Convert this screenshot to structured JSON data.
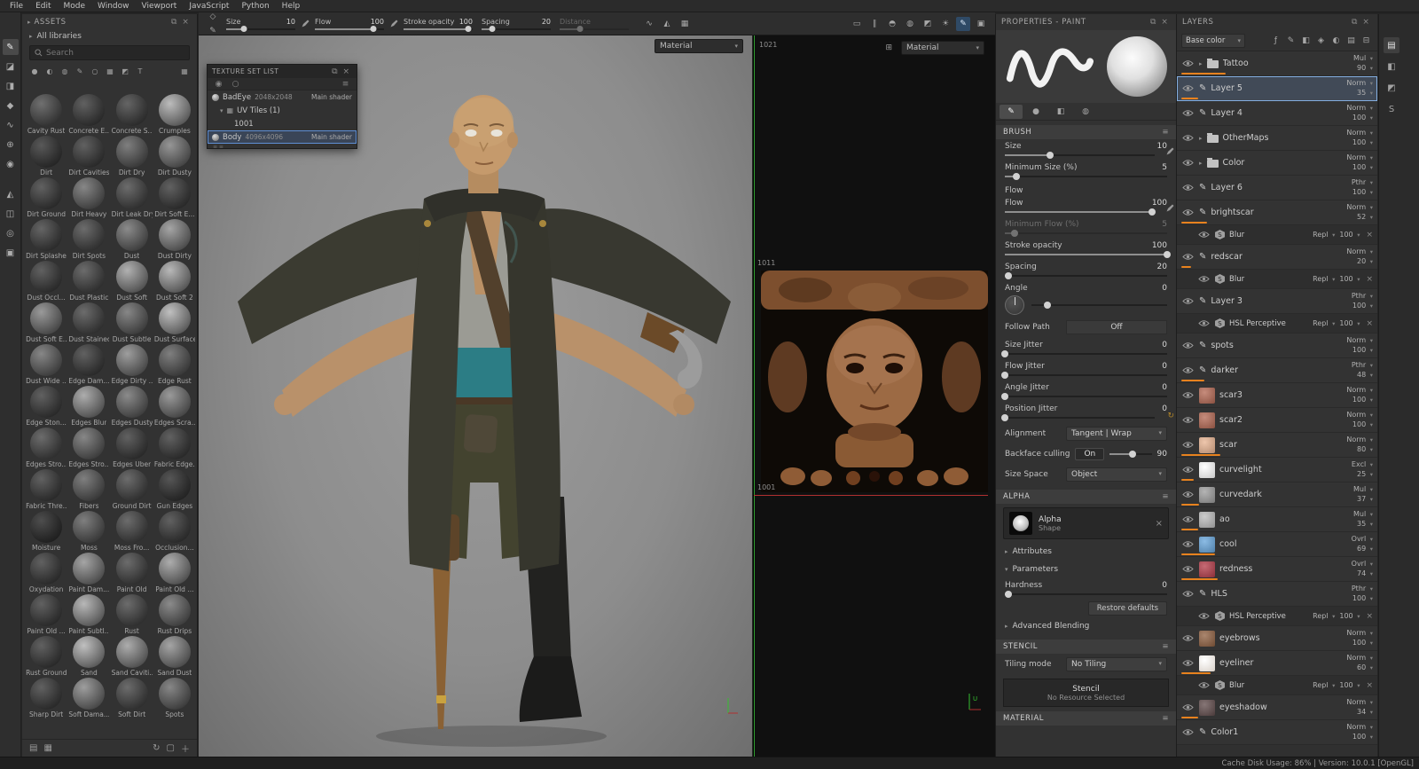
{
  "menu": {
    "items": [
      "File",
      "Edit",
      "Mode",
      "Window",
      "Viewport",
      "JavaScript",
      "Python",
      "Help"
    ]
  },
  "toolbar": {
    "left_icons": [
      {
        "name": "stroke-options-icon",
        "glyph": "◇"
      },
      {
        "name": "pen-pressure-icon",
        "glyph": "✎"
      }
    ],
    "groups": [
      {
        "label": "Size",
        "value": "10",
        "frac": 0.25,
        "pen": true
      },
      {
        "label": "Flow",
        "value": "100",
        "frac": 0.85,
        "pen": true
      },
      {
        "label": "Stroke opacity",
        "value": "100",
        "frac": 0.94
      },
      {
        "label": "Spacing",
        "value": "20",
        "frac": 0.15
      },
      {
        "label": "Distance",
        "value": "",
        "frac": 0.3,
        "disabled": true
      }
    ],
    "mid_icons": [
      {
        "name": "lazy-mouse-icon",
        "glyph": "∿"
      },
      {
        "name": "symmetry-icon",
        "glyph": "◭"
      },
      {
        "name": "tiling-icon",
        "glyph": "▦"
      }
    ],
    "viewport_icons": [
      {
        "name": "display-mode-icon",
        "glyph": "▭"
      },
      {
        "name": "pause-physics-icon",
        "glyph": "∥"
      },
      {
        "name": "simulation-icon",
        "glyph": "◓"
      },
      {
        "name": "environment-icon",
        "glyph": "◍"
      },
      {
        "name": "shader-settings-icon",
        "glyph": "◩"
      },
      {
        "name": "post-effects-icon",
        "glyph": "☀"
      },
      {
        "name": "paint-mode-icon",
        "glyph": "✎",
        "active": true
      },
      {
        "name": "camera-icon",
        "glyph": "▣"
      }
    ]
  },
  "tools": [
    {
      "name": "paint-tool",
      "glyph": "✎",
      "active": true
    },
    {
      "name": "eraser-tool",
      "glyph": "◪"
    },
    {
      "name": "projection-tool",
      "glyph": "◨"
    },
    {
      "name": "polygon-fill-tool",
      "glyph": "◆"
    },
    {
      "name": "smudge-tool",
      "glyph": "∿"
    },
    {
      "name": "clone-tool",
      "glyph": "⊕"
    },
    {
      "name": "material-picker-tool",
      "glyph": "◉"
    },
    {
      "name": "quick-mask-tool",
      "glyph": "◭",
      "gap": true
    },
    {
      "name": "symmetry-panel-tool",
      "glyph": "◫"
    },
    {
      "name": "viewer-settings-tool",
      "glyph": "◎"
    },
    {
      "name": "render-mode-tool",
      "glyph": "▣"
    }
  ],
  "assets": {
    "title": "ASSETS",
    "library_label": "All libraries",
    "search_placeholder": "Search",
    "filters": [
      {
        "name": "filter-materials-icon",
        "glyph": "●"
      },
      {
        "name": "filter-smart-materials-icon",
        "glyph": "◐"
      },
      {
        "name": "filter-smart-masks-icon",
        "glyph": "◍"
      },
      {
        "name": "filter-brushes-icon",
        "glyph": "✎"
      },
      {
        "name": "filter-alphas-icon",
        "glyph": "○"
      },
      {
        "name": "filter-textures-icon",
        "glyph": "▦"
      },
      {
        "name": "filter-environments-icon",
        "glyph": "◩"
      },
      {
        "name": "filter-fonts-icon",
        "glyph": "T"
      }
    ],
    "grid_view_icon": "▦",
    "items": [
      {
        "label": "Cavity Rust",
        "shade": 0.38
      },
      {
        "label": "Concrete E...",
        "shade": 0.3
      },
      {
        "label": "Concrete S...",
        "shade": 0.32
      },
      {
        "label": "Crumples",
        "shade": 0.78
      },
      {
        "label": "Dirt",
        "shade": 0.26
      },
      {
        "label": "Dirt Cavities",
        "shade": 0.3
      },
      {
        "label": "Dirt Dry",
        "shade": 0.46
      },
      {
        "label": "Dirt Dusty",
        "shade": 0.58
      },
      {
        "label": "Dirt Ground",
        "shade": 0.3
      },
      {
        "label": "Dirt Heavy",
        "shade": 0.5
      },
      {
        "label": "Dirt Leak Dry",
        "shade": 0.36
      },
      {
        "label": "Dirt Soft E...",
        "shade": 0.3
      },
      {
        "label": "Dirt Splashes",
        "shade": 0.32
      },
      {
        "label": "Dirt Spots",
        "shade": 0.36
      },
      {
        "label": "Dust",
        "shade": 0.52
      },
      {
        "label": "Dust Dirty",
        "shade": 0.66
      },
      {
        "label": "Dust Occl...",
        "shade": 0.3
      },
      {
        "label": "Dust Plastic",
        "shade": 0.36
      },
      {
        "label": "Dust Soft",
        "shade": 0.72
      },
      {
        "label": "Dust Soft 2",
        "shade": 0.76
      },
      {
        "label": "Dust Soft E...",
        "shade": 0.6
      },
      {
        "label": "Dust Stained",
        "shade": 0.36
      },
      {
        "label": "Dust Subtle",
        "shade": 0.5
      },
      {
        "label": "Dust Surface",
        "shade": 0.8
      },
      {
        "label": "Dust Wide ...",
        "shade": 0.5
      },
      {
        "label": "Edge Dam...",
        "shade": 0.3
      },
      {
        "label": "Edge Dirty ...",
        "shade": 0.62
      },
      {
        "label": "Edge Rust",
        "shade": 0.46
      },
      {
        "label": "Edge Ston...",
        "shade": 0.3
      },
      {
        "label": "Edges Blur",
        "shade": 0.7
      },
      {
        "label": "Edges Dusty",
        "shade": 0.52
      },
      {
        "label": "Edges Scra...",
        "shade": 0.6
      },
      {
        "label": "Edges Stro...",
        "shade": 0.36
      },
      {
        "label": "Edges Stro...",
        "shade": 0.5
      },
      {
        "label": "Edges Uber",
        "shade": 0.3
      },
      {
        "label": "Fabric Edge...",
        "shade": 0.3
      },
      {
        "label": "Fabric Thre...",
        "shade": 0.3
      },
      {
        "label": "Fibers",
        "shade": 0.46
      },
      {
        "label": "Ground Dirt",
        "shade": 0.36
      },
      {
        "label": "Gun Edges",
        "shade": 0.24
      },
      {
        "label": "Moisture",
        "shade": 0.2
      },
      {
        "label": "Moss",
        "shade": 0.46
      },
      {
        "label": "Moss Fro...",
        "shade": 0.36
      },
      {
        "label": "Occlusion...",
        "shade": 0.3
      },
      {
        "label": "Oxydation",
        "shade": 0.3
      },
      {
        "label": "Paint Dam...",
        "shade": 0.66
      },
      {
        "label": "Paint Old",
        "shade": 0.36
      },
      {
        "label": "Paint Old ...",
        "shade": 0.7
      },
      {
        "label": "Paint Old ...",
        "shade": 0.3
      },
      {
        "label": "Paint Subtl...",
        "shade": 0.76
      },
      {
        "label": "Rust",
        "shade": 0.36
      },
      {
        "label": "Rust Drips",
        "shade": 0.52
      },
      {
        "label": "Rust Ground",
        "shade": 0.3
      },
      {
        "label": "Sand",
        "shade": 0.8
      },
      {
        "label": "Sand Caviti...",
        "shade": 0.7
      },
      {
        "label": "Sand Dust",
        "shade": 0.66
      },
      {
        "label": "Sharp Dirt",
        "shade": 0.3
      },
      {
        "label": "Soft Dama...",
        "shade": 0.62
      },
      {
        "label": "Soft Dirt",
        "shade": 0.36
      },
      {
        "label": "Spots",
        "shade": 0.5
      }
    ]
  },
  "texture_set_list": {
    "title": "TEXTURE SET LIST",
    "rows": [
      {
        "name": "BadEye",
        "res": "2048x2048",
        "shader": "Main shader"
      },
      {
        "name": "UV Tiles (1)"
      },
      {
        "name": "1001"
      },
      {
        "name": "Body",
        "res": "4096x4096",
        "shader": "Main shader",
        "selected": true
      }
    ]
  },
  "viewport3d": {
    "material": "Material"
  },
  "viewport2d": {
    "material": "Material",
    "tile_top": "1021",
    "tile_mid": "1011",
    "tile_bottom": "1001",
    "axis_label": "U"
  },
  "properties": {
    "title": "PROPERTIES - PAINT",
    "tabs": [
      {
        "name": "tab-brush",
        "glyph": "✎",
        "active": true
      },
      {
        "name": "tab-alpha",
        "glyph": "●"
      },
      {
        "name": "tab-stencil",
        "glyph": "◧"
      },
      {
        "name": "tab-material",
        "glyph": "◍"
      }
    ],
    "brush_header": "BRUSH",
    "params": [
      {
        "type": "slider",
        "label": "Size",
        "value": "10",
        "frac": 0.3,
        "pen": true
      },
      {
        "type": "slider",
        "label": "Minimum Size (%)",
        "value": "5",
        "frac": 0.07
      },
      {
        "type": "subheader",
        "label": "Flow"
      },
      {
        "type": "slider",
        "label": "Flow",
        "value": "100",
        "frac": 0.98,
        "pen": true
      },
      {
        "type": "slider",
        "label": "Minimum Flow (%)",
        "value": "5",
        "frac": 0.06,
        "disabled": true
      },
      {
        "type": "slider",
        "label": "Stroke opacity",
        "value": "100",
        "frac": 1
      },
      {
        "type": "slider",
        "label": "Spacing",
        "value": "20",
        "frac": 0.02
      },
      {
        "type": "angle",
        "label": "Angle",
        "value": "0"
      },
      {
        "type": "dropdown",
        "label": "Follow Path",
        "value": "Off",
        "flat": true
      },
      {
        "type": "slider",
        "label": "Size Jitter",
        "value": "0",
        "frac": 0
      },
      {
        "type": "slider",
        "label": "Flow Jitter",
        "value": "0",
        "frac": 0
      },
      {
        "type": "slider",
        "label": "Angle Jitter",
        "value": "0",
        "frac": 0
      },
      {
        "type": "slider",
        "label": "Position Jitter",
        "value": "0",
        "frac": 0,
        "dice": true
      },
      {
        "type": "dropdown",
        "label": "Alignment",
        "value": "Tangent | Wrap"
      },
      {
        "type": "toggle",
        "label": "Backface culling",
        "value": "On",
        "extra": "90",
        "frac": 0.55
      },
      {
        "type": "dropdown",
        "label": "Size Space",
        "value": "Object"
      }
    ],
    "alpha_header": "ALPHA",
    "alpha": {
      "name": "Alpha",
      "sub": "Shape"
    },
    "attributes_label": "Attributes",
    "parameters_label": "Parameters",
    "hardness": {
      "label": "Hardness",
      "value": "0"
    },
    "restore_label": "Restore defaults",
    "advanced_label": "Advanced Blending",
    "stencil_header": "STENCIL",
    "tiling_label": "Tiling mode",
    "tiling_value": "No Tiling",
    "stencil_box": {
      "name": "Stencil",
      "sub": "No Resource Selected"
    },
    "material_header": "MATERIAL"
  },
  "layers": {
    "title": "LAYERS",
    "channel": "Base color",
    "header_icons": [
      {
        "name": "add-effect-icon",
        "glyph": "ƒ"
      },
      {
        "name": "add-paint-layer-icon",
        "glyph": "✎"
      },
      {
        "name": "add-fill-layer-icon",
        "glyph": "◧"
      },
      {
        "name": "add-smart-material-icon",
        "glyph": "◈"
      },
      {
        "name": "add-smart-mask-icon",
        "glyph": "◐"
      },
      {
        "name": "add-folder-icon",
        "glyph": "▤"
      },
      {
        "name": "delete-layer-icon",
        "glyph": "⊟"
      }
    ],
    "items": [
      {
        "kind": "folder",
        "name": "Tattoo",
        "blend": "Mul",
        "opacity": 90
      },
      {
        "kind": "paint",
        "name": "Layer 5",
        "blend": "Norm",
        "opacity": 35,
        "selected": true
      },
      {
        "kind": "paint",
        "name": "Layer 4",
        "blend": "Norm",
        "opacity": 100
      },
      {
        "kind": "folder",
        "name": "OtherMaps",
        "blend": "Norm",
        "opacity": 100
      },
      {
        "kind": "folder",
        "name": "Color",
        "blend": "Norm",
        "opacity": 100
      },
      {
        "kind": "paint",
        "name": "Layer 6",
        "blend": "Pthr",
        "opacity": 100
      },
      {
        "kind": "paint",
        "name": "brightscar",
        "blend": "Norm",
        "opacity": 52
      },
      {
        "kind": "effect",
        "name": "Blur",
        "blend": "Repl",
        "opacity": 100
      },
      {
        "kind": "paint",
        "name": "redscar",
        "blend": "Norm",
        "opacity": 20
      },
      {
        "kind": "effect",
        "name": "Blur",
        "blend": "Repl",
        "opacity": 100
      },
      {
        "kind": "paint",
        "name": "Layer 3",
        "blend": "Pthr",
        "opacity": 100
      },
      {
        "kind": "effect",
        "name": "HSL Perceptive",
        "blend": "Repl",
        "opacity": 100
      },
      {
        "kind": "paint",
        "name": "spots",
        "blend": "Norm",
        "opacity": 100
      },
      {
        "kind": "paint",
        "name": "darker",
        "blend": "Pthr",
        "opacity": 48
      },
      {
        "kind": "fill",
        "name": "scar3",
        "blend": "Norm",
        "opacity": 100,
        "thumb": "#8a5040"
      },
      {
        "kind": "fill",
        "name": "scar2",
        "blend": "Norm",
        "opacity": 100,
        "thumb": "#8a5040"
      },
      {
        "kind": "fill",
        "name": "scar",
        "blend": "Norm",
        "opacity": 80,
        "thumb": "#b28a70"
      },
      {
        "kind": "fill",
        "name": "curvelight",
        "blend": "Excl",
        "opacity": 25,
        "thumb": "#c8c8c8"
      },
      {
        "kind": "fill",
        "name": "curvedark",
        "blend": "Mul",
        "opacity": 37,
        "thumb": "#787878"
      },
      {
        "kind": "fill",
        "name": "ao",
        "blend": "Mul",
        "opacity": 35,
        "thumb": "#909090"
      },
      {
        "kind": "fill",
        "name": "cool",
        "blend": "Ovrl",
        "opacity": 69,
        "thumb": "#4f7fa8"
      },
      {
        "kind": "fill",
        "name": "redness",
        "blend": "Ovrl",
        "opacity": 74,
        "thumb": "#8a2e38"
      },
      {
        "kind": "paint",
        "name": "HLS",
        "blend": "Pthr",
        "opacity": 100
      },
      {
        "kind": "effect",
        "name": "HSL Perceptive",
        "blend": "Repl",
        "opacity": 100
      },
      {
        "kind": "fill",
        "name": "eyebrows",
        "blend": "Norm",
        "opacity": 100,
        "thumb": "#6e4a32"
      },
      {
        "kind": "fill",
        "name": "eyeliner",
        "blend": "Norm",
        "opacity": 60,
        "thumb": "#d8d0c8"
      },
      {
        "kind": "effect",
        "name": "Blur",
        "blend": "Repl",
        "opacity": 100
      },
      {
        "kind": "fill",
        "name": "eyeshadow",
        "blend": "Norm",
        "opacity": 34,
        "thumb": "#4a3a3a"
      },
      {
        "kind": "paint",
        "name": "Color1",
        "blend": "Norm",
        "opacity": 100
      }
    ]
  },
  "right_strip": {
    "tabs": [
      {
        "name": "tab-layers",
        "glyph": "▤",
        "active": true
      },
      {
        "name": "tab-texture-set-settings",
        "glyph": "◧"
      },
      {
        "name": "tab-display-settings",
        "glyph": "◩"
      },
      {
        "name": "tab-shader-settings",
        "glyph": "S"
      }
    ]
  },
  "status_bar": {
    "text": "Cache Disk Usage: 86% | Version: 10.0.1 [OpenGL]"
  },
  "colors": {
    "accent_blue": "#6f9fd8",
    "opacity_bar_orange": "#e8821e",
    "uv_green": "#35c02f",
    "uv_red": "#b03030"
  }
}
